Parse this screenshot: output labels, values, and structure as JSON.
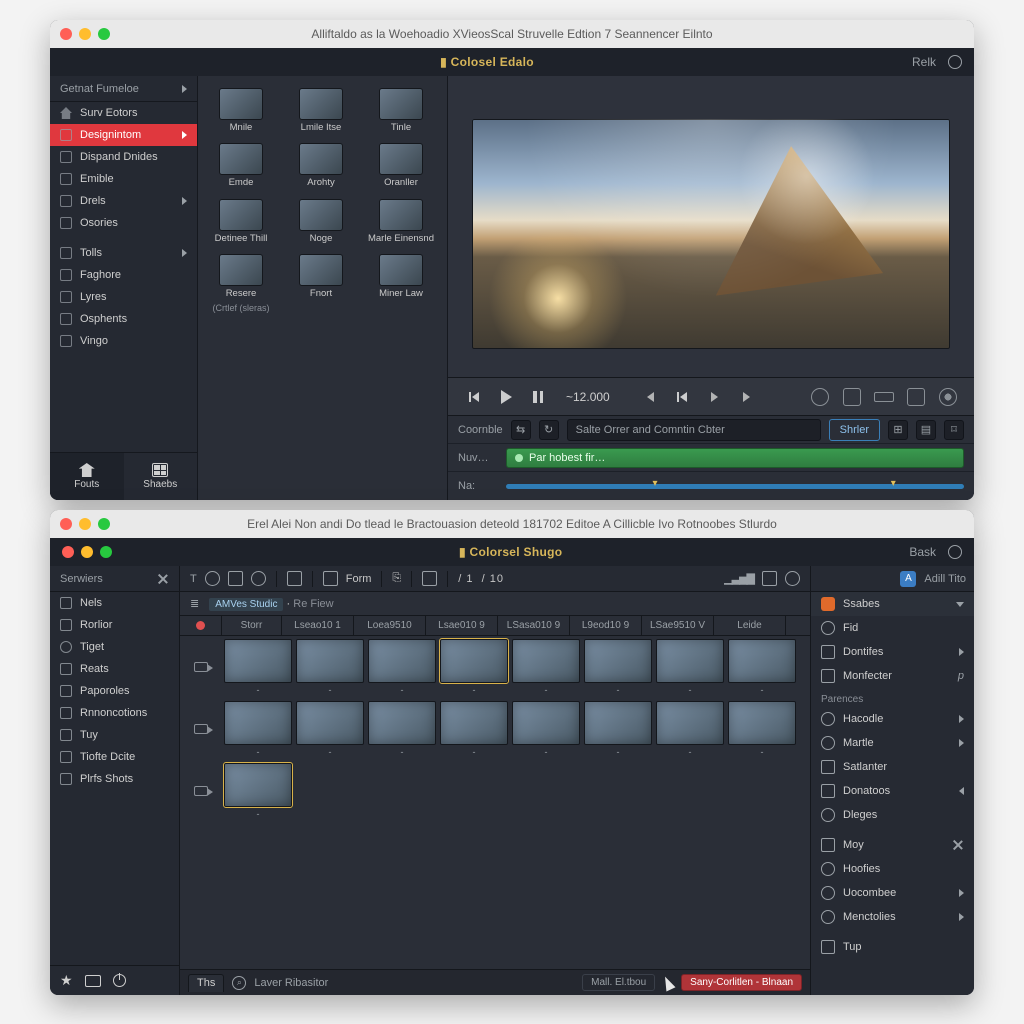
{
  "window1": {
    "titlebar": "Alliftaldo as la Woehoadio XVieosScal Struvelle Edtion 7 Seannencer Eilnto",
    "appbar": {
      "center": "Colosel Edalo",
      "right_label": "Relk"
    },
    "sidebar": {
      "header": "Getnat Fumeloe",
      "items": [
        {
          "label": "Surv Eotors",
          "ico": "home"
        },
        {
          "label": "Designintom",
          "ico": "rec",
          "selected": true,
          "chev": true
        },
        {
          "label": "Dispand Dnides",
          "ico": "list"
        },
        {
          "label": "Emible",
          "ico": "box"
        },
        {
          "label": "Drels",
          "ico": "box",
          "chev": true
        },
        {
          "label": "Osories",
          "ico": "box"
        }
      ],
      "items2": [
        {
          "label": "Tolls",
          "ico": "wrench",
          "chev": true
        },
        {
          "label": "Faghore",
          "ico": "flag"
        },
        {
          "label": "Lyres",
          "ico": "layers"
        },
        {
          "label": "Osphents",
          "ico": "grid"
        },
        {
          "label": "Vingo",
          "ico": "film"
        }
      ],
      "bottom": {
        "fonts": "Fouts",
        "sheets": "Shaebs"
      }
    },
    "assets": [
      {
        "label": "Mnile"
      },
      {
        "label": "Lmile Itse"
      },
      {
        "label": "Tinle"
      },
      {
        "label": "Emde"
      },
      {
        "label": "Arohty"
      },
      {
        "label": "Oranller"
      },
      {
        "label": "Detinee Thill"
      },
      {
        "label": "Noge"
      },
      {
        "label": "Marle Einensnd"
      },
      {
        "label": "Resere",
        "sub": "(Crtlef (sleras)"
      },
      {
        "label": "Fnort"
      },
      {
        "label": "Miner Law"
      }
    ],
    "transport": {
      "timecode": "~12.000"
    },
    "under": {
      "row1_label": "Coornble",
      "search_placeholder": "Salte Orrer and Comntin Cbter",
      "share_btn": "Shrler",
      "row2_label1": "Nuv…",
      "clip_label": "Par hobest fir…",
      "row3_label": "Na:"
    }
  },
  "window2": {
    "titlebar": "Erel Alei Non andi Do tlead le Bractouasion deteold 181702 Editoe A Cillicble Ivo Rotnoobes Stlurdo",
    "appbar": {
      "center": "Colorsel Shugo",
      "right_label": "Bask"
    },
    "sidebar": {
      "header": "Serwiers",
      "items": [
        {
          "label": "Nels",
          "ico": "box"
        },
        {
          "label": "Rorlior",
          "ico": "box"
        },
        {
          "label": "Tiget",
          "ico": "circ"
        },
        {
          "label": "Reats",
          "ico": "box"
        },
        {
          "label": "Paporoles",
          "ico": "box"
        },
        {
          "label": "Rnnoncotions",
          "ico": "box"
        },
        {
          "label": "Tuy",
          "ico": "box"
        },
        {
          "label": "Tiofte Dcite",
          "ico": "pen"
        },
        {
          "label": "Plrfs Shots",
          "ico": "grid"
        }
      ]
    },
    "toolbar": {
      "form_label": "Form",
      "page_current": "1",
      "page_total": "10"
    },
    "crumb": {
      "tag": "AMVes Studic",
      "path": "Re Fiew"
    },
    "table": {
      "first_col": "Storr",
      "headers": [
        "Lseao10 1",
        "Loea9510",
        "Lsae010 9",
        "LSasa010 9",
        "L9eod10 9",
        "LSae9510 V",
        "Leide"
      ],
      "row_clip_label": "-",
      "rows": 3
    },
    "statusbar": {
      "tab_label": "Ths",
      "search_label": "Laver Ribasitor",
      "chip": "Mall. El.tbou",
      "redchip": "Sany-Corlitlen - Blnaan"
    },
    "rightpanel": {
      "top_label": "Adill Tito",
      "primary": {
        "label": "Ssabes"
      },
      "rows": [
        {
          "ico": "target",
          "label": "Fid"
        },
        {
          "ico": "pin",
          "label": "Dontifes",
          "chev": "r"
        },
        {
          "ico": "wrench",
          "label": "Monfecter",
          "tail": "p"
        }
      ],
      "section1": "Parences",
      "rows2": [
        {
          "ico": "gear",
          "label": "Hacodle",
          "chev": "r"
        },
        {
          "ico": "dot",
          "label": "Martle",
          "chev": "r"
        },
        {
          "ico": "curve",
          "label": "Satlanter"
        },
        {
          "ico": "user",
          "label": "Donatoos",
          "chev": "l"
        },
        {
          "ico": "globe",
          "label": "Dleges"
        }
      ],
      "rows3": [
        {
          "ico": "clip",
          "label": "Moy",
          "tail": "x"
        },
        {
          "ico": "clock",
          "label": "Hoofies"
        },
        {
          "ico": "globe",
          "label": "Uocombee",
          "chev": "r"
        },
        {
          "ico": "gear",
          "label": "Menctolies",
          "chev": "r"
        }
      ],
      "rows4": [
        {
          "ico": "arrow",
          "label": "Tup"
        }
      ]
    }
  }
}
